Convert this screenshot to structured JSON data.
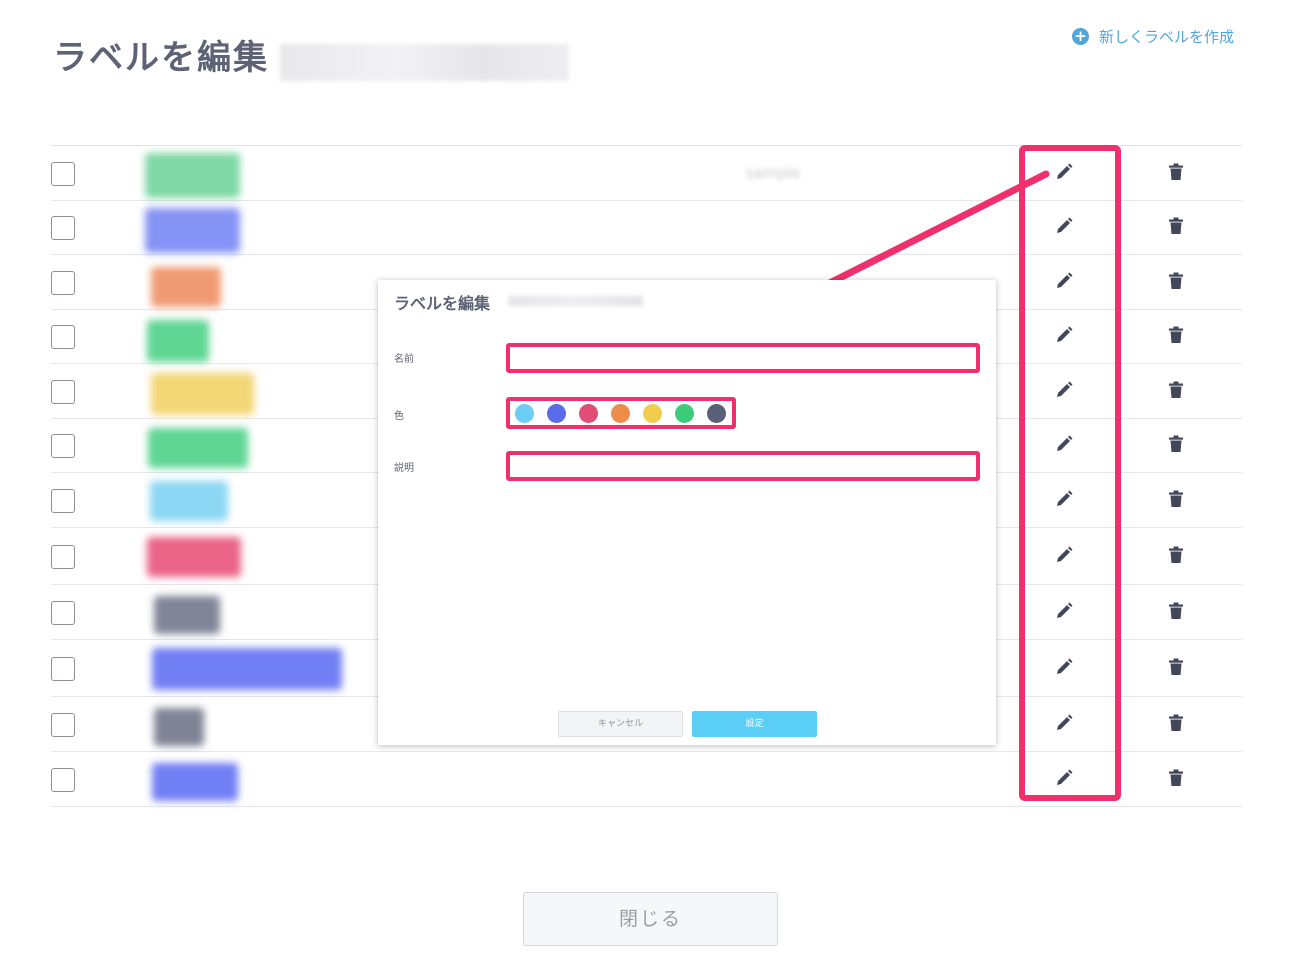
{
  "header": {
    "title": "ラベルを編集",
    "new_label": "新しくラベルを作成"
  },
  "rows": [
    {
      "color": "#7fd8a5",
      "desc": "sample"
    },
    {
      "color": "#8593f5",
      "desc": ""
    },
    {
      "color": "#f09a72",
      "desc": ""
    },
    {
      "color": "#5fd694",
      "desc": ""
    },
    {
      "color": "#f3d676",
      "desc": ""
    },
    {
      "color": "#5fd694",
      "desc": ""
    },
    {
      "color": "#8cd7f3",
      "desc": ""
    },
    {
      "color": "#ea6487",
      "desc": ""
    },
    {
      "color": "#808597",
      "desc": ""
    },
    {
      "color": "#717ff4",
      "desc": ""
    },
    {
      "color": "#7f8394",
      "desc": ""
    },
    {
      "color": "#717ff4",
      "desc": ""
    }
  ],
  "modal": {
    "title": "ラベルを編集",
    "name_label": "名前",
    "color_label": "色",
    "desc_label": "説明",
    "name_value": "",
    "desc_value": "",
    "swatches": [
      "#6ccdf5",
      "#5a6ce9",
      "#e14e75",
      "#ee8c4c",
      "#f0cd4d",
      "#3ccb7a",
      "#5a6078"
    ],
    "cancel": "キャンセル",
    "submit": "設定"
  },
  "footer": {
    "close": "閉じる"
  },
  "annotation": {
    "highlight_color": "#f0306d"
  }
}
